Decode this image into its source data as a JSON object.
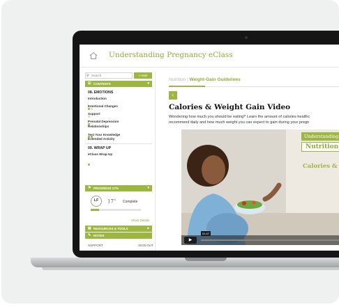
{
  "app": {
    "title": "Understanding Pregnancy eClass"
  },
  "sidebar": {
    "search_placeholder": "Search",
    "hide_label": "Hide",
    "contents_label": "CONTENTS",
    "sections": [
      {
        "title": "08. EMOTIONS",
        "items": [
          {
            "label": "Introduction"
          },
          {
            "label": "Emotional Changes"
          },
          {
            "label": "Support"
          },
          {
            "label": "Prenatal Depression"
          },
          {
            "label": "Relationships"
          },
          {
            "label": "Test Your Knowledge"
          },
          {
            "label": "Extended Activity"
          }
        ]
      },
      {
        "title": "09. WRAP UP",
        "items": [
          {
            "label": "eClass Wrap-Up"
          }
        ]
      }
    ],
    "progress": {
      "header": "PROGRESS 17%",
      "initials": "LF",
      "percent": "17",
      "percent_suffix": "%",
      "status": "Complete",
      "fraction": 0.17,
      "show_details": "Show Details"
    },
    "resources_label": "RESOURCES & TOOLS",
    "notes_label": "NOTES",
    "footer": {
      "support": "SUPPORT",
      "sign_out": "SIGN OUT"
    }
  },
  "main": {
    "breadcrumb_parent": "Nutrition",
    "breadcrumb_separator": "|",
    "breadcrumb_current": "Weight-Gain Guidelines",
    "back_glyph": "‹",
    "title": "Calories & Weight Gain Video",
    "description_line1": "Wondering how much you should be eating? Learn the amount of calories healthc",
    "description_line2": "recommend daily and how much weight you can expect to gain during your pregn",
    "video": {
      "overlay_line1": "Understanding",
      "overlay_line2": "Nutrition",
      "overlay_line3": "Calories & W",
      "time": "01:47",
      "play_glyph": "▶"
    }
  },
  "colors": {
    "accent": "#9cb641",
    "accent_text": "#8fab3a"
  }
}
